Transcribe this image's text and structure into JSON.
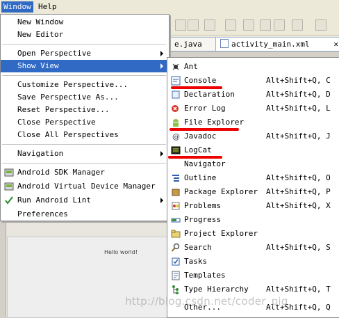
{
  "menubar": {
    "window": "Window",
    "help": "Help"
  },
  "editor": {
    "tab1": "e.java",
    "tab2": "activity_main.xml",
    "tab2_close": "✕",
    "hello": "Hello world!"
  },
  "window_menu": {
    "items": [
      {
        "label": "New Window"
      },
      {
        "label": "New Editor"
      },
      {
        "label": "Open Perspective"
      },
      {
        "label": "Show View"
      },
      {
        "label": "Customize Perspective..."
      },
      {
        "label": "Save Perspective As..."
      },
      {
        "label": "Reset Perspective..."
      },
      {
        "label": "Close Perspective"
      },
      {
        "label": "Close All Perspectives"
      },
      {
        "label": "Navigation"
      },
      {
        "label": "Android SDK Manager"
      },
      {
        "label": "Android Virtual Device Manager"
      },
      {
        "label": "Run Android Lint"
      },
      {
        "label": "Preferences"
      }
    ]
  },
  "show_view_menu": {
    "items": [
      {
        "label": "Ant",
        "shortcut": "",
        "icon": "ant-icon"
      },
      {
        "label": "Console",
        "shortcut": "Alt+Shift+Q, C",
        "icon": "console-icon"
      },
      {
        "label": "Declaration",
        "shortcut": "Alt+Shift+Q, D",
        "icon": "declaration-icon"
      },
      {
        "label": "Error Log",
        "shortcut": "Alt+Shift+Q, L",
        "icon": "error-log-icon"
      },
      {
        "label": "File Explorer",
        "shortcut": "",
        "icon": "android-icon"
      },
      {
        "label": "Javadoc",
        "shortcut": "Alt+Shift+Q, J",
        "icon": "javadoc-icon"
      },
      {
        "label": "LogCat",
        "shortcut": "",
        "icon": "logcat-icon"
      },
      {
        "label": "Navigator",
        "shortcut": "",
        "icon": "navigator-icon"
      },
      {
        "label": "Outline",
        "shortcut": "Alt+Shift+Q, O",
        "icon": "outline-icon"
      },
      {
        "label": "Package Explorer",
        "shortcut": "Alt+Shift+Q, P",
        "icon": "package-icon"
      },
      {
        "label": "Problems",
        "shortcut": "Alt+Shift+Q, X",
        "icon": "problems-icon"
      },
      {
        "label": "Progress",
        "shortcut": "",
        "icon": "progress-icon"
      },
      {
        "label": "Project Explorer",
        "shortcut": "",
        "icon": "project-explorer-icon"
      },
      {
        "label": "Search",
        "shortcut": "Alt+Shift+Q, S",
        "icon": "search-icon"
      },
      {
        "label": "Tasks",
        "shortcut": "",
        "icon": "tasks-icon"
      },
      {
        "label": "Templates",
        "shortcut": "",
        "icon": "templates-icon"
      },
      {
        "label": "Type Hierarchy",
        "shortcut": "Alt+Shift+Q, T",
        "icon": "hierarchy-icon"
      },
      {
        "label": "Other...",
        "shortcut": "Alt+Shift+Q, Q",
        "icon": ""
      }
    ]
  },
  "watermark": "http://blog.csdn.net/coder_pig",
  "colors": {
    "highlight": "#316ac5",
    "annotation": "#e00000"
  }
}
